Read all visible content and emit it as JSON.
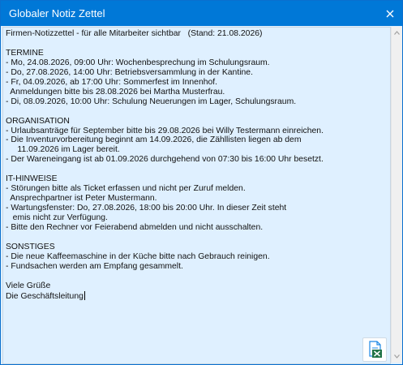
{
  "window": {
    "title": "Globaler Notiz Zettel"
  },
  "note": {
    "text": "Firmen-Notizzettel - für alle Mitarbeiter sichtbar   (Stand: 21.08.2026)\n\nTERMINE\n- Mo, 24.08.2026, 09:00 Uhr: Wochenbesprechung im Schulungsraum.\n- Do, 27.08.2026, 14:00 Uhr: Betriebsversammlung in der Kantine.\n- Fr, 04.09.2026, ab 17:00 Uhr: Sommerfest im Innenhof.\n  Anmeldungen bitte bis 28.08.2026 bei Martha Musterfrau.\n- Di, 08.09.2026, 10:00 Uhr: Schulung Neuerungen im Lager, Schulungsraum.\n\nORGANISATION\n- Urlaubsanträge für September bitte bis 29.08.2026 bei Willy Testermann einreichen.\n- Die Inventurvorbereitung beginnt am 14.09.2026, die Zähllisten liegen ab dem\n     11.09.2026 im Lager bereit.\n- Der Wareneingang ist ab 01.09.2026 durchgehend von 07:30 bis 16:00 Uhr besetzt.\n\nIT-HINWEISE\n- Störungen bitte als Ticket erfassen und nicht per Zuruf melden.\n  Ansprechpartner ist Peter Mustermann.\n- Wartungsfenster: Do, 27.08.2026, 18:00 bis 20:00 Uhr. In dieser Zeit steht\n   emis nicht zur Verfügung.\n- Bitte den Rechner vor Feierabend abmelden und nicht ausschalten.\n\nSONSTIGES\n- Die neue Kaffeemaschine in der Küche bitte nach Gebrauch reinigen.\n- Fundsachen werden am Empfang gesammelt.\n\nViele Grüße\nDie Geschäftsleitung"
  },
  "icons": {
    "close": "close-icon",
    "scroll_up": "arrow-up-icon",
    "scroll_down": "arrow-down-icon",
    "export": "excel-export-icon"
  },
  "colors": {
    "titlebar": "#0078d7",
    "background": "#dff0ff",
    "excel_green": "#217346",
    "export_blue": "#1e88e5"
  }
}
